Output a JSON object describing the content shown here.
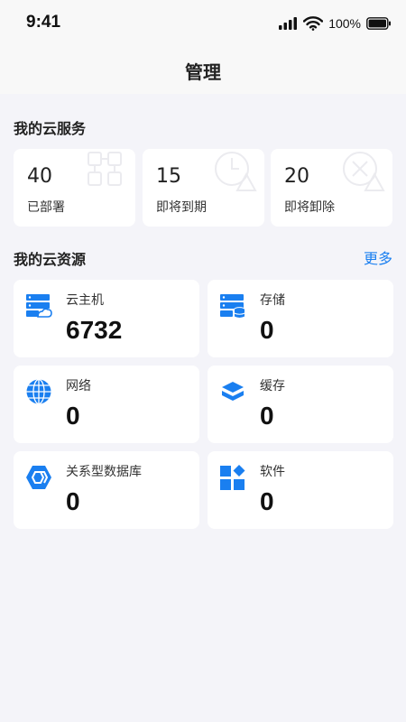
{
  "status_bar": {
    "time": "9:41",
    "battery": "100%"
  },
  "nav": {
    "title": "管理"
  },
  "services": {
    "title": "我的云服务",
    "items": [
      {
        "value": "40",
        "label": "已部署"
      },
      {
        "value": "15",
        "label": "即将到期"
      },
      {
        "value": "20",
        "label": "即将卸除"
      }
    ]
  },
  "resources": {
    "title": "我的云资源",
    "more": "更多",
    "items": [
      {
        "label": "云主机",
        "value": "6732",
        "icon": "cloud-server-icon"
      },
      {
        "label": "存储",
        "value": "0",
        "icon": "storage-icon"
      },
      {
        "label": "网络",
        "value": "0",
        "icon": "globe-icon"
      },
      {
        "label": "缓存",
        "value": "0",
        "icon": "cache-layers-icon"
      },
      {
        "label": "关系型数据库",
        "value": "0",
        "icon": "database-hexagon-icon"
      },
      {
        "label": "软件",
        "value": "0",
        "icon": "software-grid-icon"
      }
    ]
  },
  "colors": {
    "accent": "#1a7ff0",
    "background": "#f4f4f9",
    "card": "#ffffff"
  }
}
